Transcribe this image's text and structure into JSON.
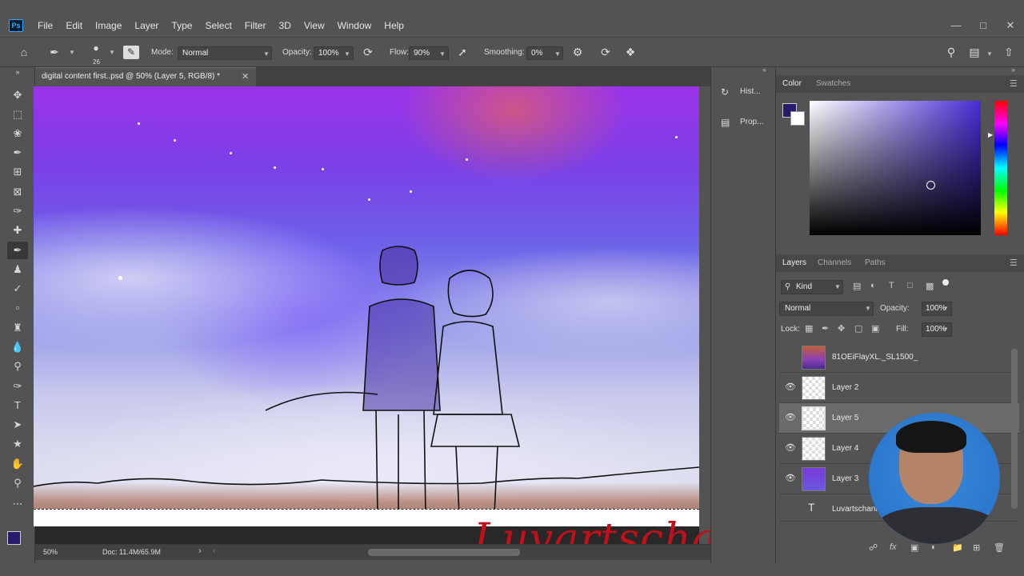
{
  "app": {
    "logo": "Ps"
  },
  "menu": [
    "File",
    "Edit",
    "Image",
    "Layer",
    "Type",
    "Select",
    "Filter",
    "3D",
    "View",
    "Window",
    "Help"
  ],
  "window_controls": [
    "minimize-icon",
    "restore-icon",
    "close-icon"
  ],
  "options": {
    "brush_size": "26",
    "mode_label": "Mode:",
    "mode_value": "Normal",
    "opacity_label": "Opacity:",
    "opacity_value": "100%",
    "flow_label": "Flow:",
    "flow_value": "90%",
    "smoothing_label": "Smoothing:",
    "smoothing_value": "0%"
  },
  "document": {
    "tab_title": "digital content first..psd @ 50% (Layer 5, RGB/8) *",
    "zoom": "50%",
    "doc_info": "Doc: 11.4M/65.9M"
  },
  "mid_panel": {
    "history": "Hist...",
    "properties": "Prop..."
  },
  "color_panel": {
    "tabs": [
      "Color",
      "Swatches"
    ],
    "foreground": "#2a1a6a",
    "background": "#ffffff"
  },
  "layers_panel": {
    "tabs": [
      "Layers",
      "Channels",
      "Paths"
    ],
    "filter_kind": "Kind",
    "blend_mode": "Normal",
    "opacity_label": "Opacity:",
    "opacity_value": "100%",
    "lock_label": "Lock:",
    "fill_label": "Fill:",
    "fill_value": "100%",
    "layers": [
      {
        "name": "81OEiFlayXL._SL1500_",
        "visible": false,
        "selected": false
      },
      {
        "name": "Layer 2",
        "visible": true,
        "selected": false
      },
      {
        "name": "Layer 5",
        "visible": true,
        "selected": true
      },
      {
        "name": "Layer 4",
        "visible": true,
        "selected": false
      },
      {
        "name": "Layer 3",
        "visible": true,
        "selected": false
      },
      {
        "name": "Luvartschannel",
        "visible": false,
        "selected": false
      }
    ]
  },
  "watermark": "Luvartschannel"
}
